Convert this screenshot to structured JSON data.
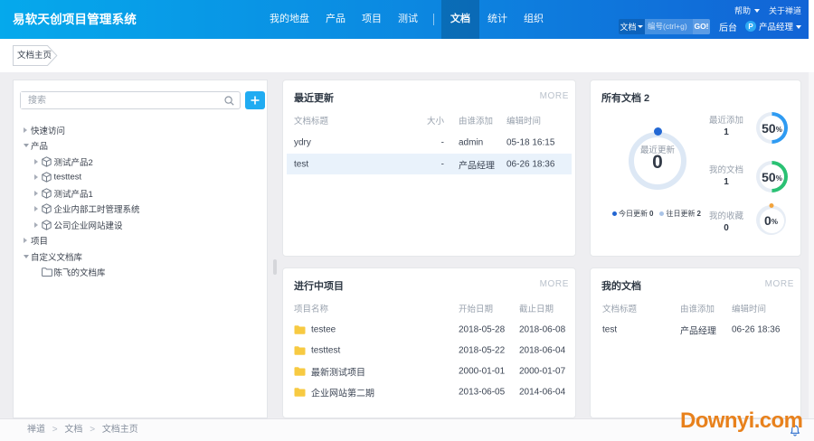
{
  "header": {
    "logo": "易软天创项目管理系统",
    "nav": [
      {
        "label": "我的地盘",
        "active": false
      },
      {
        "label": "产品",
        "active": false
      },
      {
        "label": "项目",
        "active": false
      },
      {
        "label": "测试",
        "active": false
      },
      {
        "label": "文档",
        "active": true
      },
      {
        "label": "统计",
        "active": false
      },
      {
        "label": "组织",
        "active": false
      }
    ],
    "help": "帮助",
    "about": "关于禅道",
    "search_scope": "文档",
    "search_placeholder": "编号(ctrl+g)",
    "go_label": "GO!",
    "admin_label": "后台",
    "avatar_letter": "P",
    "user_name": "产品经理"
  },
  "tabbar": {
    "home_tab": "文档主页"
  },
  "sidebar": {
    "search_placeholder": "搜索",
    "tree": [
      {
        "label": "快速访问",
        "level": 0,
        "caret": "right",
        "icon": "none"
      },
      {
        "label": "产品",
        "level": 0,
        "caret": "down",
        "icon": "none"
      },
      {
        "label": "测试产品2",
        "level": 1,
        "caret": "right",
        "icon": "product"
      },
      {
        "label": "testtest",
        "level": 1,
        "caret": "right",
        "icon": "product"
      },
      {
        "label": "测试产品1",
        "level": 1,
        "caret": "right",
        "icon": "product"
      },
      {
        "label": "企业内部工时管理系统",
        "level": 1,
        "caret": "right",
        "icon": "product"
      },
      {
        "label": "公司企业网站建设",
        "level": 1,
        "caret": "right",
        "icon": "product"
      },
      {
        "label": "项目",
        "level": 0,
        "caret": "right",
        "icon": "none"
      },
      {
        "label": "自定义文档库",
        "level": 0,
        "caret": "down",
        "icon": "none"
      },
      {
        "label": "陈飞的文档库",
        "level": 1,
        "caret": "none",
        "icon": "folder"
      }
    ]
  },
  "cards": {
    "recent": {
      "title": "最近更新",
      "more": "MORE",
      "headers": [
        "文档标题",
        "大小",
        "由谁添加",
        "编辑时间"
      ],
      "rows": [
        {
          "title": "ydry",
          "size": "-",
          "added_by": "admin",
          "edited": "05-18 16:15",
          "highlight": false
        },
        {
          "title": "test",
          "size": "-",
          "added_by": "产品经理",
          "edited": "06-26 18:36",
          "highlight": true
        }
      ]
    },
    "alldocs": {
      "title": "所有文档 2",
      "donut": {
        "label": "最近更新",
        "value": "0",
        "ring_color": "#dde8f5",
        "dot_color": "#2368d4"
      },
      "legend": [
        {
          "label": "今日更新",
          "value": "0",
          "color": "#2265d1"
        },
        {
          "label": "往日更新",
          "value": "2",
          "color": "#a9c3e6"
        }
      ],
      "stats": [
        {
          "label": "最近添加",
          "value": "1",
          "pct": "50",
          "pct_sign": "%",
          "pct_num": 50,
          "color": "#2f9bf2"
        },
        {
          "label": "我的文档",
          "value": "1",
          "pct": "50",
          "pct_sign": "%",
          "pct_num": 50,
          "color": "#2ac173"
        },
        {
          "label": "我的收藏",
          "value": "0",
          "pct": "0",
          "pct_sign": "%",
          "pct_num": 0,
          "color": "#f2a33c"
        }
      ]
    },
    "projects": {
      "title": "进行中项目",
      "more": "MORE",
      "headers": [
        "项目名称",
        "开始日期",
        "截止日期"
      ],
      "rows": [
        {
          "name": "testee",
          "start": "2018-05-28",
          "end": "2018-06-08"
        },
        {
          "name": "testtest",
          "start": "2018-05-22",
          "end": "2018-06-04"
        },
        {
          "name": "最新测试项目",
          "start": "2000-01-01",
          "end": "2000-01-07"
        },
        {
          "name": "企业网站第二期",
          "start": "2013-06-05",
          "end": "2014-06-04"
        }
      ]
    },
    "mydocs": {
      "title": "我的文档",
      "more": "MORE",
      "headers": [
        "文档标题",
        "由谁添加",
        "编辑时间"
      ],
      "rows": [
        {
          "title": "test",
          "added_by": "产品经理",
          "edited": "06-26 18:36"
        }
      ]
    }
  },
  "footer": {
    "breadcrumb": [
      "禅道",
      "文档",
      "文档主页"
    ],
    "separator": ">"
  },
  "watermark": "Downyi.com",
  "colors": {
    "header_gradient_left": "#05a9ec",
    "header_gradient_right": "#1264d6",
    "accent_blue": "#2f9bf2",
    "accent_green": "#2ac173",
    "accent_orange": "#f2a33c",
    "highlight_row": "#e9f2fb",
    "watermark_orange": "#e8811c"
  }
}
